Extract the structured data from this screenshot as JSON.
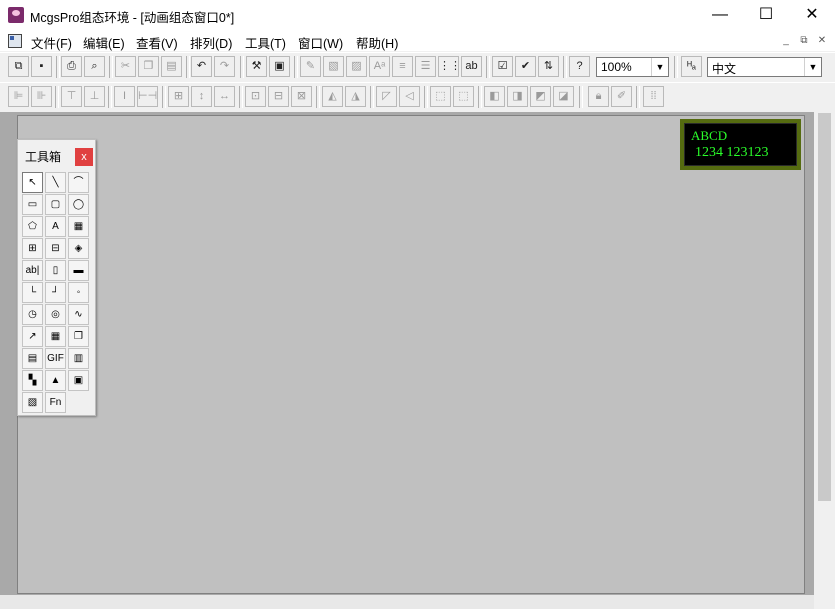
{
  "window": {
    "title": "McgsPro组态环境 - [动画组态窗口0*]"
  },
  "menu": [
    "文件(F)",
    "编辑(E)",
    "查看(V)",
    "排列(D)",
    "工具(T)",
    "窗口(W)",
    "帮助(H)"
  ],
  "toolbar1": {
    "zoom_value": "100%",
    "language_value": "中文",
    "buttons": [
      "new-window",
      "save",
      "print",
      "print-preview",
      "cut",
      "copy",
      "paste",
      "undo",
      "redo",
      "tools",
      "window-properties",
      "brush",
      "fill",
      "line-style",
      "font-size",
      "align-h",
      "align-v",
      "grid",
      "spell",
      "properties",
      "check",
      "sort",
      "help"
    ]
  },
  "toolbar2": {
    "buttons": [
      "align-left",
      "align-right",
      "align-top",
      "align-bottom",
      "center-v",
      "center-h",
      "same-size",
      "same-width",
      "same-height",
      "group",
      "ungroup",
      "front",
      "back",
      "rotate-left",
      "rotate-right",
      "flip-h",
      "flip-v",
      "frame",
      "multi-frame",
      "layer-up",
      "layer-down",
      "layer-front",
      "layer-back",
      "lock",
      "unlock",
      "grid-dots"
    ]
  },
  "toolbox": {
    "title": "工具箱",
    "close_label": "x",
    "tools": [
      {
        "name": "pointer",
        "glyph": "↖"
      },
      {
        "name": "line",
        "glyph": "╲"
      },
      {
        "name": "arc",
        "glyph": "⌒"
      },
      {
        "name": "rectangle",
        "glyph": "▭"
      },
      {
        "name": "rounded-rectangle",
        "glyph": "▢"
      },
      {
        "name": "ellipse",
        "glyph": "◯"
      },
      {
        "name": "polygon",
        "glyph": "⬠"
      },
      {
        "name": "text",
        "glyph": "A"
      },
      {
        "name": "bitmap",
        "glyph": "▦"
      },
      {
        "name": "insert-element",
        "glyph": "⊞"
      },
      {
        "name": "save-element",
        "glyph": "⊟"
      },
      {
        "name": "common-symbol",
        "glyph": "◈"
      },
      {
        "name": "input-box",
        "glyph": "ab|"
      },
      {
        "name": "slider",
        "glyph": "▯"
      },
      {
        "name": "indicator",
        "glyph": "▬"
      },
      {
        "name": "pipe-corner",
        "glyph": "└"
      },
      {
        "name": "pipe-step",
        "glyph": "┘"
      },
      {
        "name": "connector",
        "glyph": "◦"
      },
      {
        "name": "meter",
        "glyph": "◷"
      },
      {
        "name": "selector",
        "glyph": "◎"
      },
      {
        "name": "trend",
        "glyph": "∿"
      },
      {
        "name": "chart",
        "glyph": "↗"
      },
      {
        "name": "grid",
        "glyph": "▦"
      },
      {
        "name": "stack",
        "glyph": "❐"
      },
      {
        "name": "report",
        "glyph": "▤"
      },
      {
        "name": "gif",
        "glyph": "GIF"
      },
      {
        "name": "ruler",
        "glyph": "▥"
      },
      {
        "name": "qrcode",
        "glyph": "▚"
      },
      {
        "name": "alarm-light",
        "glyph": "▲"
      },
      {
        "name": "screen",
        "glyph": "▣"
      },
      {
        "name": "picture-list",
        "glyph": "▧"
      },
      {
        "name": "function",
        "glyph": "Fn"
      }
    ]
  },
  "led": {
    "line1": "ABCD",
    "line2": "1234 123123"
  }
}
